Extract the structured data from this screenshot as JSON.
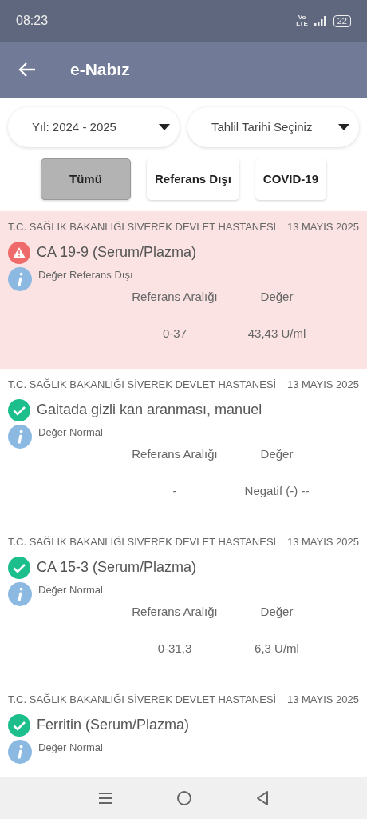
{
  "status_bar": {
    "time": "08:23",
    "network": "Vo\nLTE",
    "battery": "22"
  },
  "app_bar": {
    "title": "e-Nabız"
  },
  "filters": [
    {
      "value": "Yıl: 2024 - 2025"
    },
    {
      "value": "Tahlil Tarihi Seçiniz"
    }
  ],
  "tabs": [
    {
      "label": "Tümü",
      "selected": true
    },
    {
      "label": "Referans Dışı",
      "selected": false
    },
    {
      "label": "COVID-19",
      "selected": false
    }
  ],
  "results": [
    {
      "kind": "out_of_range",
      "hospital": "T.C. SAĞLIK BAKANLIĞI SİVEREK DEVLET HASTANESİ",
      "date": "13 MAYIS 2025",
      "test": "CA 19-9 (Serum/Plazma)",
      "status_text": "Değer Referans Dışı",
      "range_label": "Referans Aralığı",
      "value_label": "Değer",
      "range": "0-37",
      "value": "43,43 U/ml"
    },
    {
      "kind": "normal",
      "hospital": "T.C. SAĞLIK BAKANLIĞI SİVEREK DEVLET HASTANESİ",
      "date": "13 MAYIS 2025",
      "test": "Gaitada gizli kan aranması, manuel",
      "status_text": "Değer Normal",
      "range_label": "Referans Aralığı",
      "value_label": "Değer",
      "range": "-",
      "value": "Negatif (-) --"
    },
    {
      "kind": "normal",
      "hospital": "T.C. SAĞLIK BAKANLIĞI SİVEREK DEVLET HASTANESİ",
      "date": "13 MAYIS 2025",
      "test": "CA 15-3 (Serum/Plazma)",
      "status_text": "Değer Normal",
      "range_label": "Referans Aralığı",
      "value_label": "Değer",
      "range": "0-31,3",
      "value": "6,3 U/ml"
    },
    {
      "kind": "normal",
      "hospital": "T.C. SAĞLIK BAKANLIĞI SİVEREK DEVLET HASTANESİ",
      "date": "13 MAYIS 2025",
      "test": "Ferritin (Serum/Plazma)",
      "status_text": "Değer Normal"
    }
  ]
}
